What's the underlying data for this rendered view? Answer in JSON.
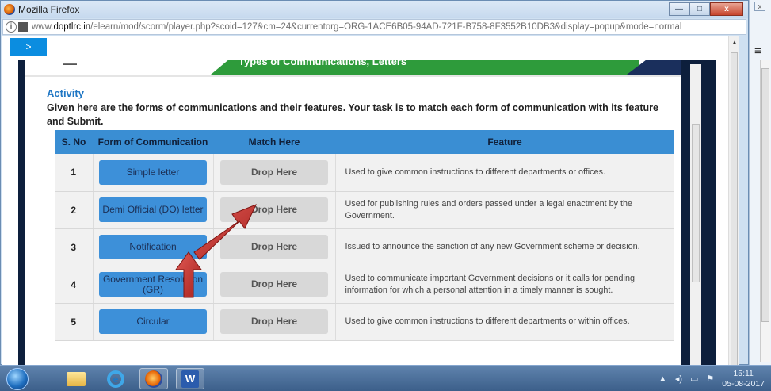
{
  "window": {
    "title": "Mozilla Firefox",
    "url_prefix": "www.",
    "url_domain": "doptlrc.in",
    "url_rest": "/elearn/mod/scorm/player.php?scoid=127&cm=24&currentorg=ORG-1ACE6B05-94AD-721F-B758-8F3552B10DB3&display=popup&mode=normal",
    "minimize_glyph": "—",
    "maximize_glyph": "□",
    "close_glyph": "x"
  },
  "nav": {
    "next_label": ">"
  },
  "banner": {
    "title": "Types of Communications, Letters"
  },
  "activity": {
    "heading": "Activity",
    "instruction": "Given here are the forms of communications and their features. Your task is to match each form of communication with its feature and Submit."
  },
  "table": {
    "headers": {
      "sno": "S. No",
      "form": "Form of Communication",
      "match": "Match Here",
      "feature": "Feature"
    },
    "rows": [
      {
        "sno": "1",
        "form": "Simple letter",
        "drop": "Drop Here",
        "feature": "Used to give common instructions to different departments or offices."
      },
      {
        "sno": "2",
        "form": "Demi Official (DO) letter",
        "drop": "Drop Here",
        "feature": "Used for publishing rules and orders passed under a legal enactment by the Government."
      },
      {
        "sno": "3",
        "form": "Notification",
        "drop": "Drop Here",
        "feature": "Issued to announce the sanction of any new Government scheme or decision."
      },
      {
        "sno": "4",
        "form": "Government Resolution (GR)",
        "drop": "Drop Here",
        "feature": "Used to communicate important Government decisions or it calls for pending information for which a personal attention in a timely manner is sought."
      },
      {
        "sno": "5",
        "form": "Circular",
        "drop": "Drop Here",
        "feature": "Used to give common instructions to different departments or within offices."
      }
    ]
  },
  "side": {
    "close_glyph": "x",
    "menu_glyph": "≡"
  },
  "taskbar": {
    "time": "15:11",
    "date": "05-08-2017",
    "word_glyph": "W",
    "ie_glyph": "e",
    "tray_arrow": "▲",
    "volume_glyph": "◂)",
    "network_glyph": "▭",
    "flag_glyph": "⚑"
  },
  "colors": {
    "header_blue": "#3a8ed3",
    "button_blue": "#3d90d9",
    "arrow_red": "#c9302c",
    "banner_green": "#2e9b3b"
  }
}
